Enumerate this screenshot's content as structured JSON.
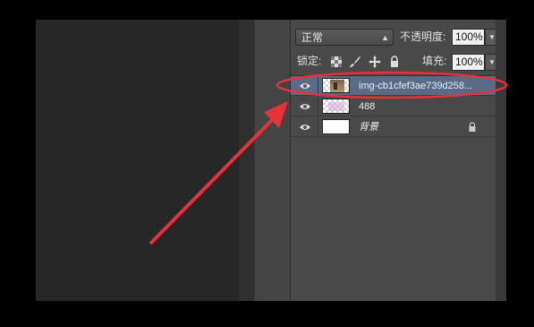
{
  "layers_panel": {
    "blend_mode": "正常",
    "opacity_label": "不透明度:",
    "opacity_value": "100%",
    "lock_label": "锁定:",
    "fill_label": "填充:",
    "fill_value": "100%",
    "lock_icons": [
      "lock-transparent-pixels-icon",
      "lock-image-pixels-icon",
      "lock-position-icon",
      "lock-all-icon"
    ],
    "layers": [
      {
        "name": "img-cb1cfef3ae739d258...",
        "selected": true,
        "thumb": "image-thumbnail"
      },
      {
        "name": "488",
        "selected": false,
        "thumb": "transparent-thumbnail"
      },
      {
        "name": "背景",
        "selected": false,
        "thumb": "white-thumbnail",
        "locked": true
      }
    ]
  },
  "colors": {
    "selected_layer": "#586b87",
    "annotation_red": "#e8323a"
  }
}
